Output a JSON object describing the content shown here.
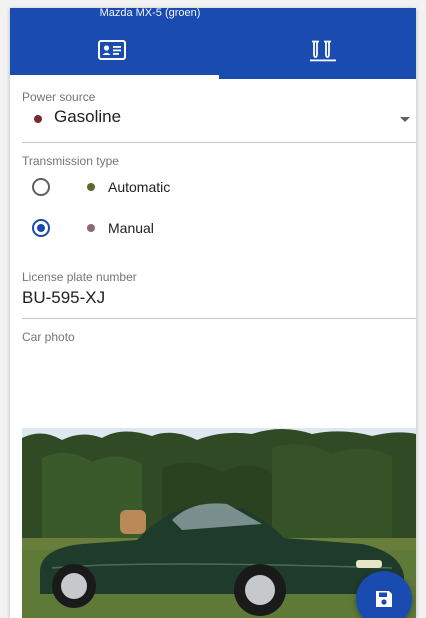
{
  "app": {
    "title": "Mazda MX-5 (groen)",
    "accent_color": "#1a4bb0"
  },
  "tabs": [
    {
      "icon": "id-card-icon",
      "selected": true
    },
    {
      "icon": "test-tubes-icon",
      "selected": false
    }
  ],
  "power_source": {
    "label": "Power source",
    "value": "Gasoline",
    "dot_color": "#7a2a2f"
  },
  "transmission": {
    "label": "Transmission type",
    "options": [
      {
        "label": "Automatic",
        "dot_color": "#5a6a2a",
        "selected": false
      },
      {
        "label": "Manual",
        "dot_color": "#8a6a78",
        "selected": true
      }
    ]
  },
  "license_plate": {
    "label": "License plate number",
    "value": "BU-595-XJ"
  },
  "car_photo": {
    "label": "Car photo"
  },
  "save_button": {
    "icon": "save-icon"
  }
}
